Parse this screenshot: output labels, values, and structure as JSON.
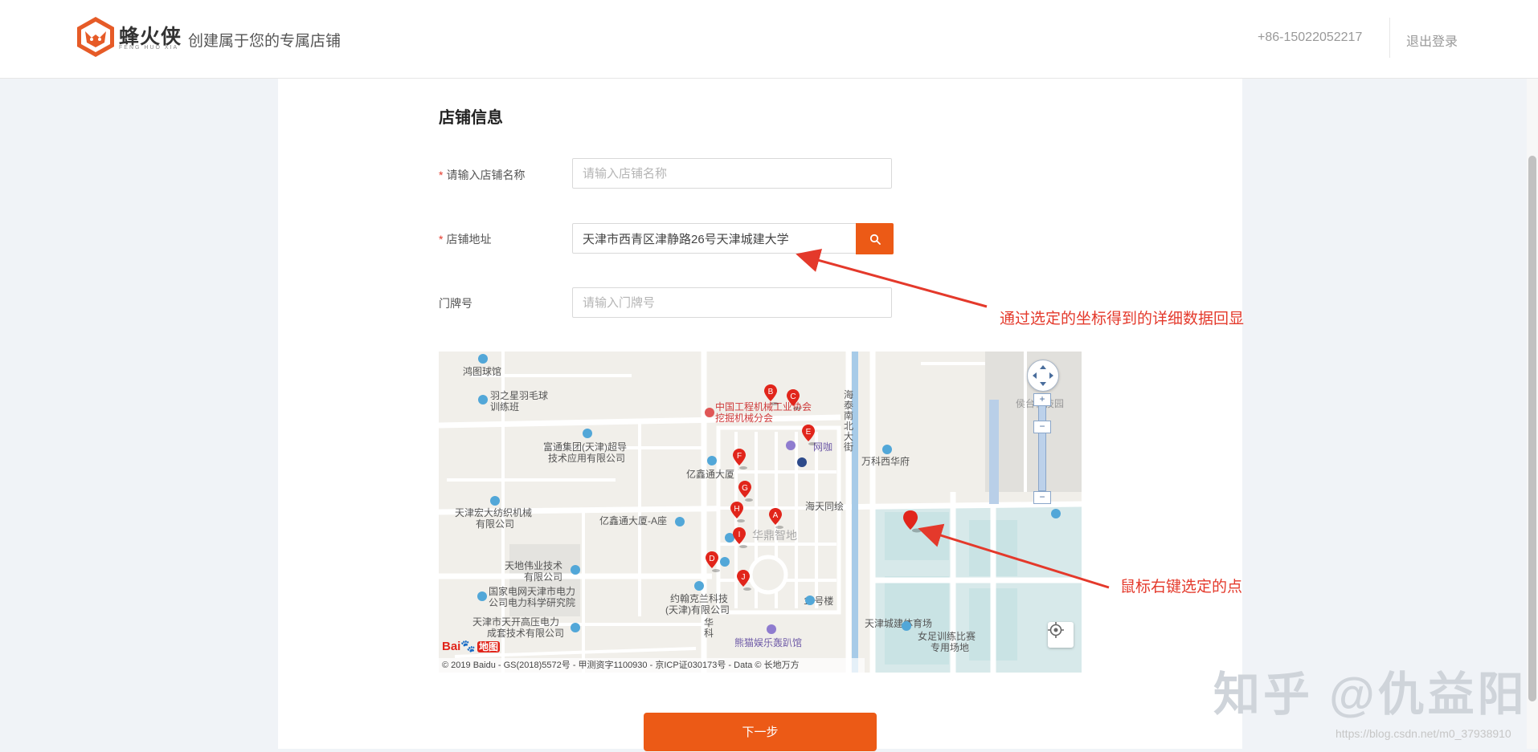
{
  "header": {
    "logo_name": "蜂火侠",
    "logo_sub": "FENG HUO XIA",
    "slogan": "创建属于您的专属店铺",
    "phone": "+86-15022052217",
    "logout": "退出登录"
  },
  "form": {
    "section_title": "店铺信息",
    "required_mark": "*",
    "store_name_label": "请输入店铺名称",
    "store_name_placeholder": "请输入店铺名称",
    "address_label": "店铺地址",
    "address_value": "天津市西青区津静路26号天津城建大学",
    "door_label": "门牌号",
    "door_placeholder": "请输入门牌号",
    "next_button": "下一步"
  },
  "map": {
    "labels": [
      "鸿图球馆",
      "羽之星羽毛球",
      "训练班",
      "中国工程机械工业协会",
      "挖掘机械分会",
      "富通集团(天津)超导",
      "技术应用有限公司",
      "亿鑫通大厦",
      "天津宏大纺织机械",
      "有限公司",
      "亿鑫通大厦-A座",
      "海天同绘",
      "华鼎智地",
      "天地伟业技术",
      "有限公司",
      "国家电网天津市电力",
      "公司电力科学研究院",
      "天津市天开高压电力",
      "成套技术有限公司",
      "约翰克兰科技",
      "(天津)有限公司",
      "19号楼",
      "熊猫娱乐轰趴馆",
      "天津城建体育场",
      "女足训练比赛",
      "专用场地",
      "万科西华府",
      "侯台科技园",
      "海泰南北大街",
      "网咖",
      "华科"
    ],
    "pin_letters": [
      "A",
      "B",
      "C",
      "D",
      "E",
      "F",
      "G",
      "H",
      "I",
      "J"
    ],
    "footer": "© 2019 Baidu - GS(2018)5572号 - 甲测资字1100930 - 京ICP证030173号 - Data © 长地万方",
    "baidu_logo": "Bai",
    "baidu_logo_map": "地图",
    "zoom_in": "+",
    "zoom_out": "−",
    "accent_pin": "#e1251b"
  },
  "annotations": {
    "top": "通过选定的坐标得到的详细数据回显",
    "bottom": "鼠标右键选定的点",
    "color": "#e4392b"
  },
  "watermarks": {
    "zhihu": "知乎 @仇益阳",
    "csdn": "https://blog.csdn.net/m0_37938910"
  },
  "colors": {
    "brand": "#ec5a16",
    "required": "#e4392b"
  }
}
